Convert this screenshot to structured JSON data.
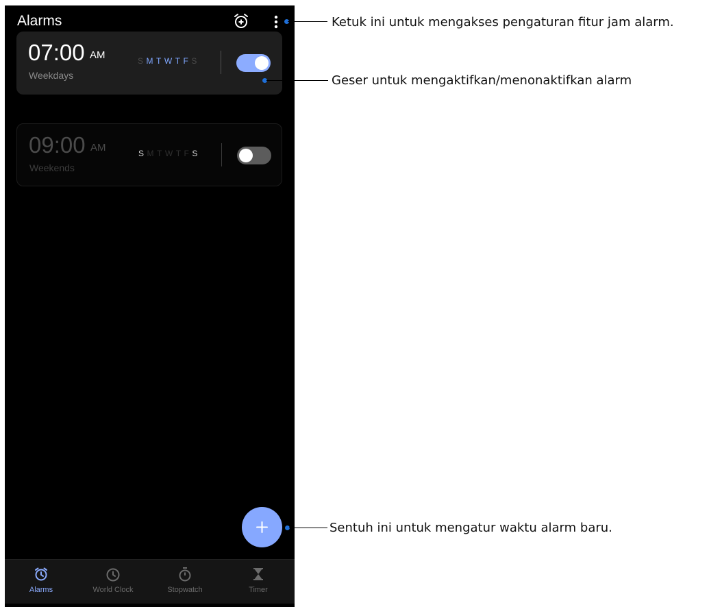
{
  "header": {
    "title": "Alarms",
    "add_alarm_icon": "alarm-add-icon",
    "more_icon": "more-vert-icon"
  },
  "alarms": [
    {
      "time": "07:00",
      "ampm": "AM",
      "label": "Weekdays",
      "enabled": true,
      "days": [
        {
          "letter": "S",
          "active": false
        },
        {
          "letter": "M",
          "active": true
        },
        {
          "letter": "T",
          "active": true
        },
        {
          "letter": "W",
          "active": true
        },
        {
          "letter": "T",
          "active": true
        },
        {
          "letter": "F",
          "active": true
        },
        {
          "letter": "S",
          "active": false
        }
      ]
    },
    {
      "time": "09:00",
      "ampm": "AM",
      "label": "Weekends",
      "enabled": false,
      "days": [
        {
          "letter": "S",
          "active": true
        },
        {
          "letter": "M",
          "active": false
        },
        {
          "letter": "T",
          "active": false
        },
        {
          "letter": "W",
          "active": false
        },
        {
          "letter": "T",
          "active": false
        },
        {
          "letter": "F",
          "active": false
        },
        {
          "letter": "S",
          "active": true
        }
      ]
    }
  ],
  "fab": {
    "icon": "plus-icon"
  },
  "nav": [
    {
      "label": "Alarms",
      "icon": "alarm-icon",
      "active": true
    },
    {
      "label": "World Clock",
      "icon": "clock-icon",
      "active": false
    },
    {
      "label": "Stopwatch",
      "icon": "stopwatch-icon",
      "active": false
    },
    {
      "label": "Timer",
      "icon": "hourglass-icon",
      "active": false
    }
  ],
  "callouts": {
    "settings": "Ketuk ini untuk mengakses pengaturan fitur jam alarm.",
    "toggle": "Geser untuk mengaktifkan/menonaktifkan alarm",
    "new_alarm": "Sentuh ini untuk mengatur waktu alarm baru."
  },
  "colors": {
    "accent": "#8cacff",
    "fab": "#86a8ff",
    "callout_dot": "#1f6fd8",
    "background": "#000000"
  }
}
